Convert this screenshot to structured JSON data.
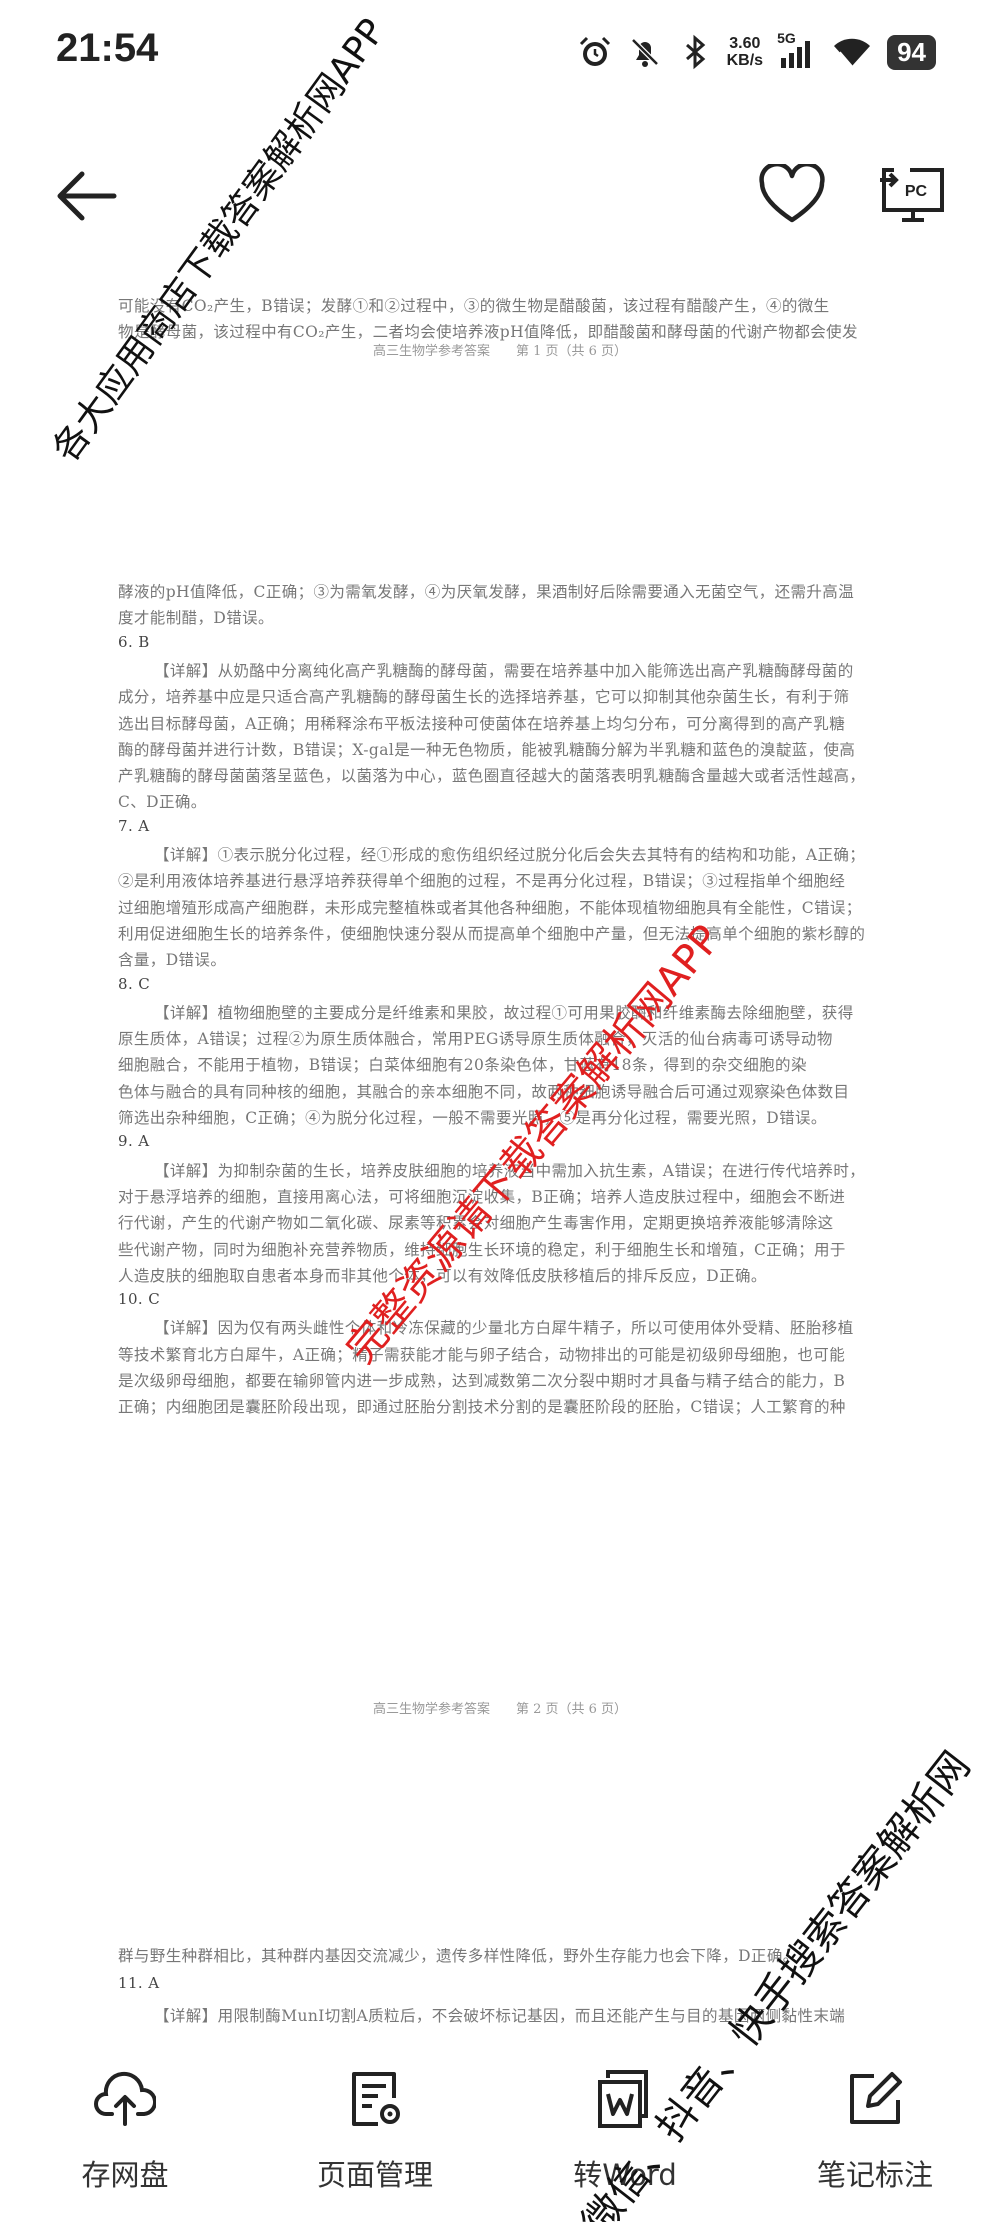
{
  "status_bar": {
    "time": "21:54",
    "net_speed_value": "3.60",
    "net_speed_unit": "KB/s",
    "signal_label": "5G",
    "battery": "94",
    "icons": [
      "alarm-icon",
      "mute-bell-icon",
      "bluetooth-icon",
      "signal-icon",
      "wifi-icon",
      "battery-icon"
    ]
  },
  "app_bar": {
    "icons": [
      "back-arrow-icon",
      "heart-icon",
      "send-to-pc-icon"
    ],
    "pc_label": "PC"
  },
  "document": {
    "page1_lines": [
      "可能没有CO₂产生，B错误；发酵①和②过程中，③的微生物是醋酸菌，该过程有醋酸产生，④的微生",
      "物是酵母菌，该过程中有CO₂产生，二者均会使培养液pH值降低，即醋酸菌和酵母菌的代谢产物都会使发"
    ],
    "page1_footer": "高三生物学参考答案　　第 1 页（共 6 页）",
    "page2_lines": [
      {
        "text": "酵液的pH值降低，C正确；③为需氧发酵，④为厌氧发酵，果酒制好后除需要通入无菌空气，还需升高温",
        "type": "plain"
      },
      {
        "text": "度才能制醋，D错误。",
        "type": "plain"
      },
      {
        "text": "6. B",
        "type": "num"
      },
      {
        "text": "【详解】从奶酪中分离纯化高产乳糖酶的酵母菌，需要在培养基中加入能筛选出高产乳糖酶酵母菌的",
        "type": "indent"
      },
      {
        "text": "成分，培养基中应是只适合高产乳糖酶的酵母菌生长的选择培养基，它可以抑制其他杂菌生长，有利于筛",
        "type": "plain"
      },
      {
        "text": "选出目标酵母菌，A正确；用稀释涂布平板法接种可使菌体在培养基上均匀分布，可分离得到的高产乳糖",
        "type": "plain"
      },
      {
        "text": "酶的酵母菌并进行计数，B错误；X-gal是一种无色物质，能被乳糖酶分解为半乳糖和蓝色的溴靛蓝，使高",
        "type": "plain"
      },
      {
        "text": "产乳糖酶的酵母菌菌落呈蓝色，以菌落为中心，蓝色圈直径越大的菌落表明乳糖酶含量越大或者活性越高，",
        "type": "plain"
      },
      {
        "text": "C、D正确。",
        "type": "plain"
      },
      {
        "text": "7. A",
        "type": "num"
      },
      {
        "text": "【详解】①表示脱分化过程，经①形成的愈伤组织经过脱分化后会失去其特有的结构和功能，A正确；",
        "type": "indent"
      },
      {
        "text": "②是利用液体培养基进行悬浮培养获得单个细胞的过程，不是再分化过程，B错误；③过程指单个细胞经",
        "type": "plain"
      },
      {
        "text": "过细胞增殖形成高产细胞群，未形成完整植株或者其他各种细胞，不能体现植物细胞具有全能性，C错误；",
        "type": "plain"
      },
      {
        "text": "利用促进细胞生长的培养条件，使细胞快速分裂从而提高单个细胞中产量，但无法提高单个细胞的紫杉醇的",
        "type": "plain"
      },
      {
        "text": "含量，D错误。",
        "type": "plain"
      },
      {
        "text": "8. C",
        "type": "num"
      },
      {
        "text": "【详解】植物细胞壁的主要成分是纤维素和果胶，故过程①可用果胶酶和纤维素酶去除细胞壁，获得",
        "type": "indent"
      },
      {
        "text": "原生质体，A错误；过程②为原生质体融合，常用PEG诱导原生质体融合，灭活的仙台病毒可诱导动物",
        "type": "plain"
      },
      {
        "text": "细胞融合，不能用于植物，B错误；白菜体细胞有20条染色体，甘蓝有18条，得到的杂交细胞的染",
        "type": "plain"
      },
      {
        "text": "色体与融合的具有同种核的细胞，其融合的亲本细胞不同，故两种细胞诱导融合后可通过观察染色体数目",
        "type": "plain"
      },
      {
        "text": "筛选出杂种细胞，C正确；④为脱分化过程，一般不需要光照，⑤是再分化过程，需要光照，D错误。",
        "type": "plain"
      },
      {
        "text": "9. A",
        "type": "num"
      },
      {
        "text": "【详解】为抑制杂菌的生长，培养皮肤细胞的培养液当中需加入抗生素，A错误；在进行传代培养时，",
        "type": "indent"
      },
      {
        "text": "对于悬浮培养的细胞，直接用离心法，可将细胞沉淀收集，B正确；培养人造皮肤过程中，细胞会不断进",
        "type": "plain"
      },
      {
        "text": "行代谢，产生的代谢产物如二氧化碳、尿素等积累会对细胞产生毒害作用，定期更换培养液能够清除这",
        "type": "plain"
      },
      {
        "text": "些代谢产物，同时为细胞补充营养物质，维持细胞生长环境的稳定，利于细胞生长和增殖，C正确；用于",
        "type": "plain"
      },
      {
        "text": "人造皮肤的细胞取自患者本身而非其他个体，可以有效降低皮肤移植后的排斥反应，D正确。",
        "type": "plain"
      },
      {
        "text": "10. C",
        "type": "num"
      },
      {
        "text": "【详解】因为仅有两头雌性个体和冷冻保藏的少量北方白犀牛精子，所以可使用体外受精、胚胎移植",
        "type": "indent"
      },
      {
        "text": "等技术繁育北方白犀牛，A正确；精子需获能才能与卵子结合，动物排出的可能是初级卵母细胞，也可能",
        "type": "plain"
      },
      {
        "text": "是次级卵母细胞，都要在输卵管内进一步成熟，达到减数第二次分裂中期时才具备与精子结合的能力，B",
        "type": "plain"
      },
      {
        "text": "正确；内细胞团是囊胚阶段出现，即通过胚胎分割技术分割的是囊胚阶段的胚胎，C错误；人工繁育的种",
        "type": "plain"
      }
    ],
    "page2_footer": "高三生物学参考答案　　第 2 页（共 6 页）",
    "page3_lines": [
      {
        "text": "群与野生种群相比，其种群内基因交流减少，遗传多样性降低，野外生存能力也会下降，D正确。",
        "type": "plain"
      },
      {
        "text": "11. A",
        "type": "num"
      },
      {
        "text": "【详解】用限制酶MunⅠ切割A质粒后，不会破坏标记基因，而且还能产生与目的基因两侧黏性末端",
        "type": "indent"
      }
    ]
  },
  "watermarks": {
    "top_left": "各大应用商店下载答案解析网APP",
    "middle": "完整资源请下载答案解析网APP",
    "bottom_right": "微信、抖音、快手搜索答案解析网"
  },
  "toolbar": {
    "items": [
      {
        "label": "存网盘",
        "icon": "cloud-upload-icon"
      },
      {
        "label": "页面管理",
        "icon": "page-settings-icon"
      },
      {
        "label": "转Word",
        "icon": "word-convert-icon"
      },
      {
        "label": "笔记标注",
        "icon": "edit-note-icon"
      }
    ]
  }
}
